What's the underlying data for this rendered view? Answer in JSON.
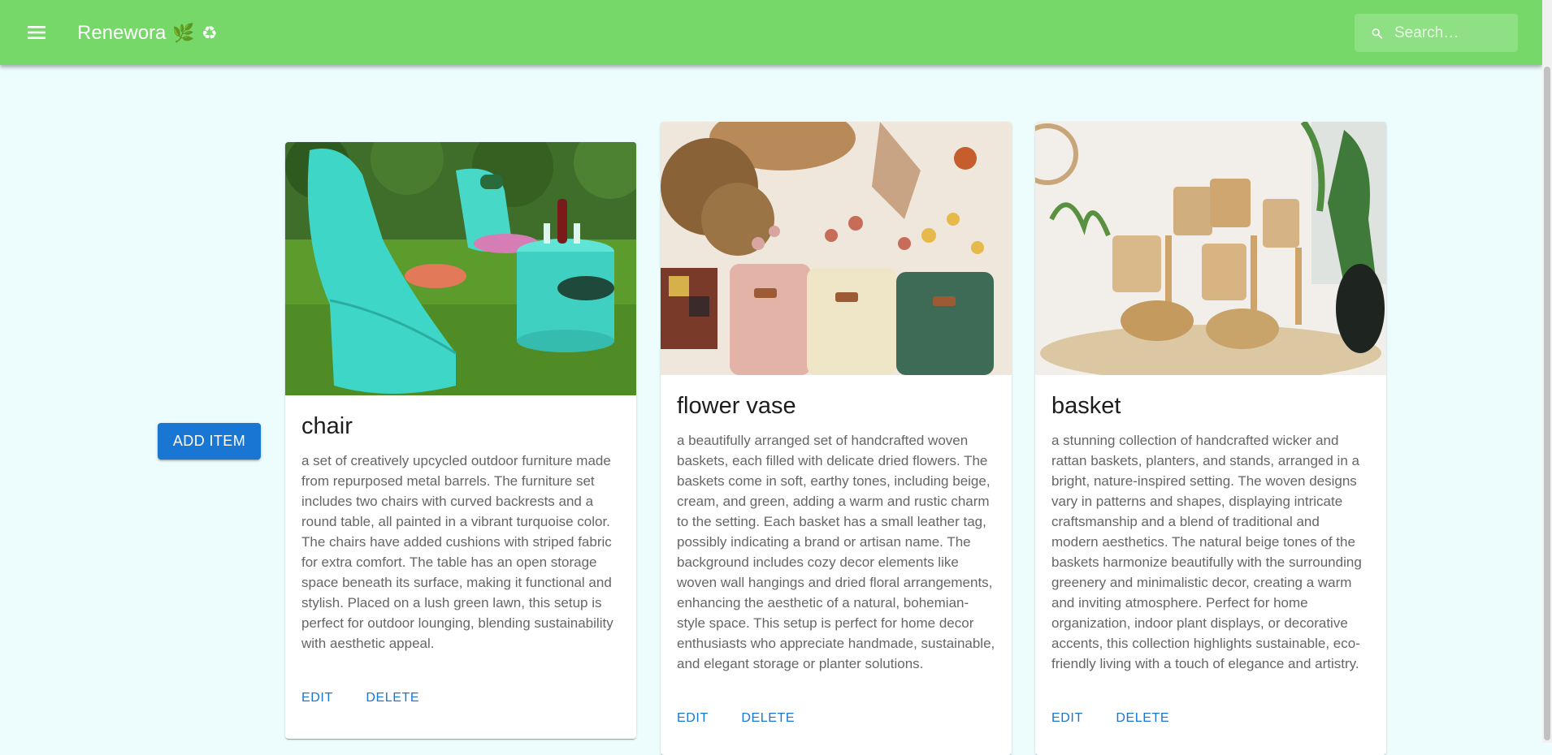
{
  "appbar": {
    "title": "Renewora",
    "leaf_icon": "🌿",
    "recycle_icon": "♻",
    "search_placeholder": "Search…",
    "color": "#77d86a"
  },
  "main": {
    "add_button_label": "ADD ITEM",
    "cards": [
      {
        "title": "chair",
        "description": "a set of creatively upcycled outdoor furniture made from repurposed metal barrels. The furniture set includes two chairs with curved backrests and a round table, all painted in a vibrant turquoise color. The chairs have added cushions with striped fabric for extra comfort. The table has an open storage space beneath its surface, making it functional and stylish. Placed on a lush green lawn, this setup is perfect for outdoor lounging, blending sustainability with aesthetic appeal.",
        "edit_label": "EDIT",
        "delete_label": "DELETE"
      },
      {
        "title": "flower vase",
        "description": "a beautifully arranged set of handcrafted woven baskets, each filled with delicate dried flowers. The baskets come in soft, earthy tones, including beige, cream, and green, adding a warm and rustic charm to the setting. Each basket has a small leather tag, possibly indicating a brand or artisan name. The background includes cozy decor elements like woven wall hangings and dried floral arrangements, enhancing the aesthetic of a natural, bohemian-style space. This setup is perfect for home decor enthusiasts who appreciate handmade, sustainable, and elegant storage or planter solutions.",
        "edit_label": "EDIT",
        "delete_label": "DELETE"
      },
      {
        "title": "basket",
        "description": "a stunning collection of handcrafted wicker and rattan baskets, planters, and stands, arranged in a bright, nature-inspired setting. The woven designs vary in patterns and shapes, displaying intricate craftsmanship and a blend of traditional and modern aesthetics. The natural beige tones of the baskets harmonize beautifully with the surrounding greenery and minimalistic decor, creating a warm and inviting atmosphere. Perfect for home organization, indoor plant displays, or decorative accents, this collection highlights sustainable, eco-friendly living with a touch of elegance and artistry.",
        "edit_label": "EDIT",
        "delete_label": "DELETE"
      }
    ]
  },
  "colors": {
    "primary": "#1976d2",
    "background": "#edfdfd"
  }
}
